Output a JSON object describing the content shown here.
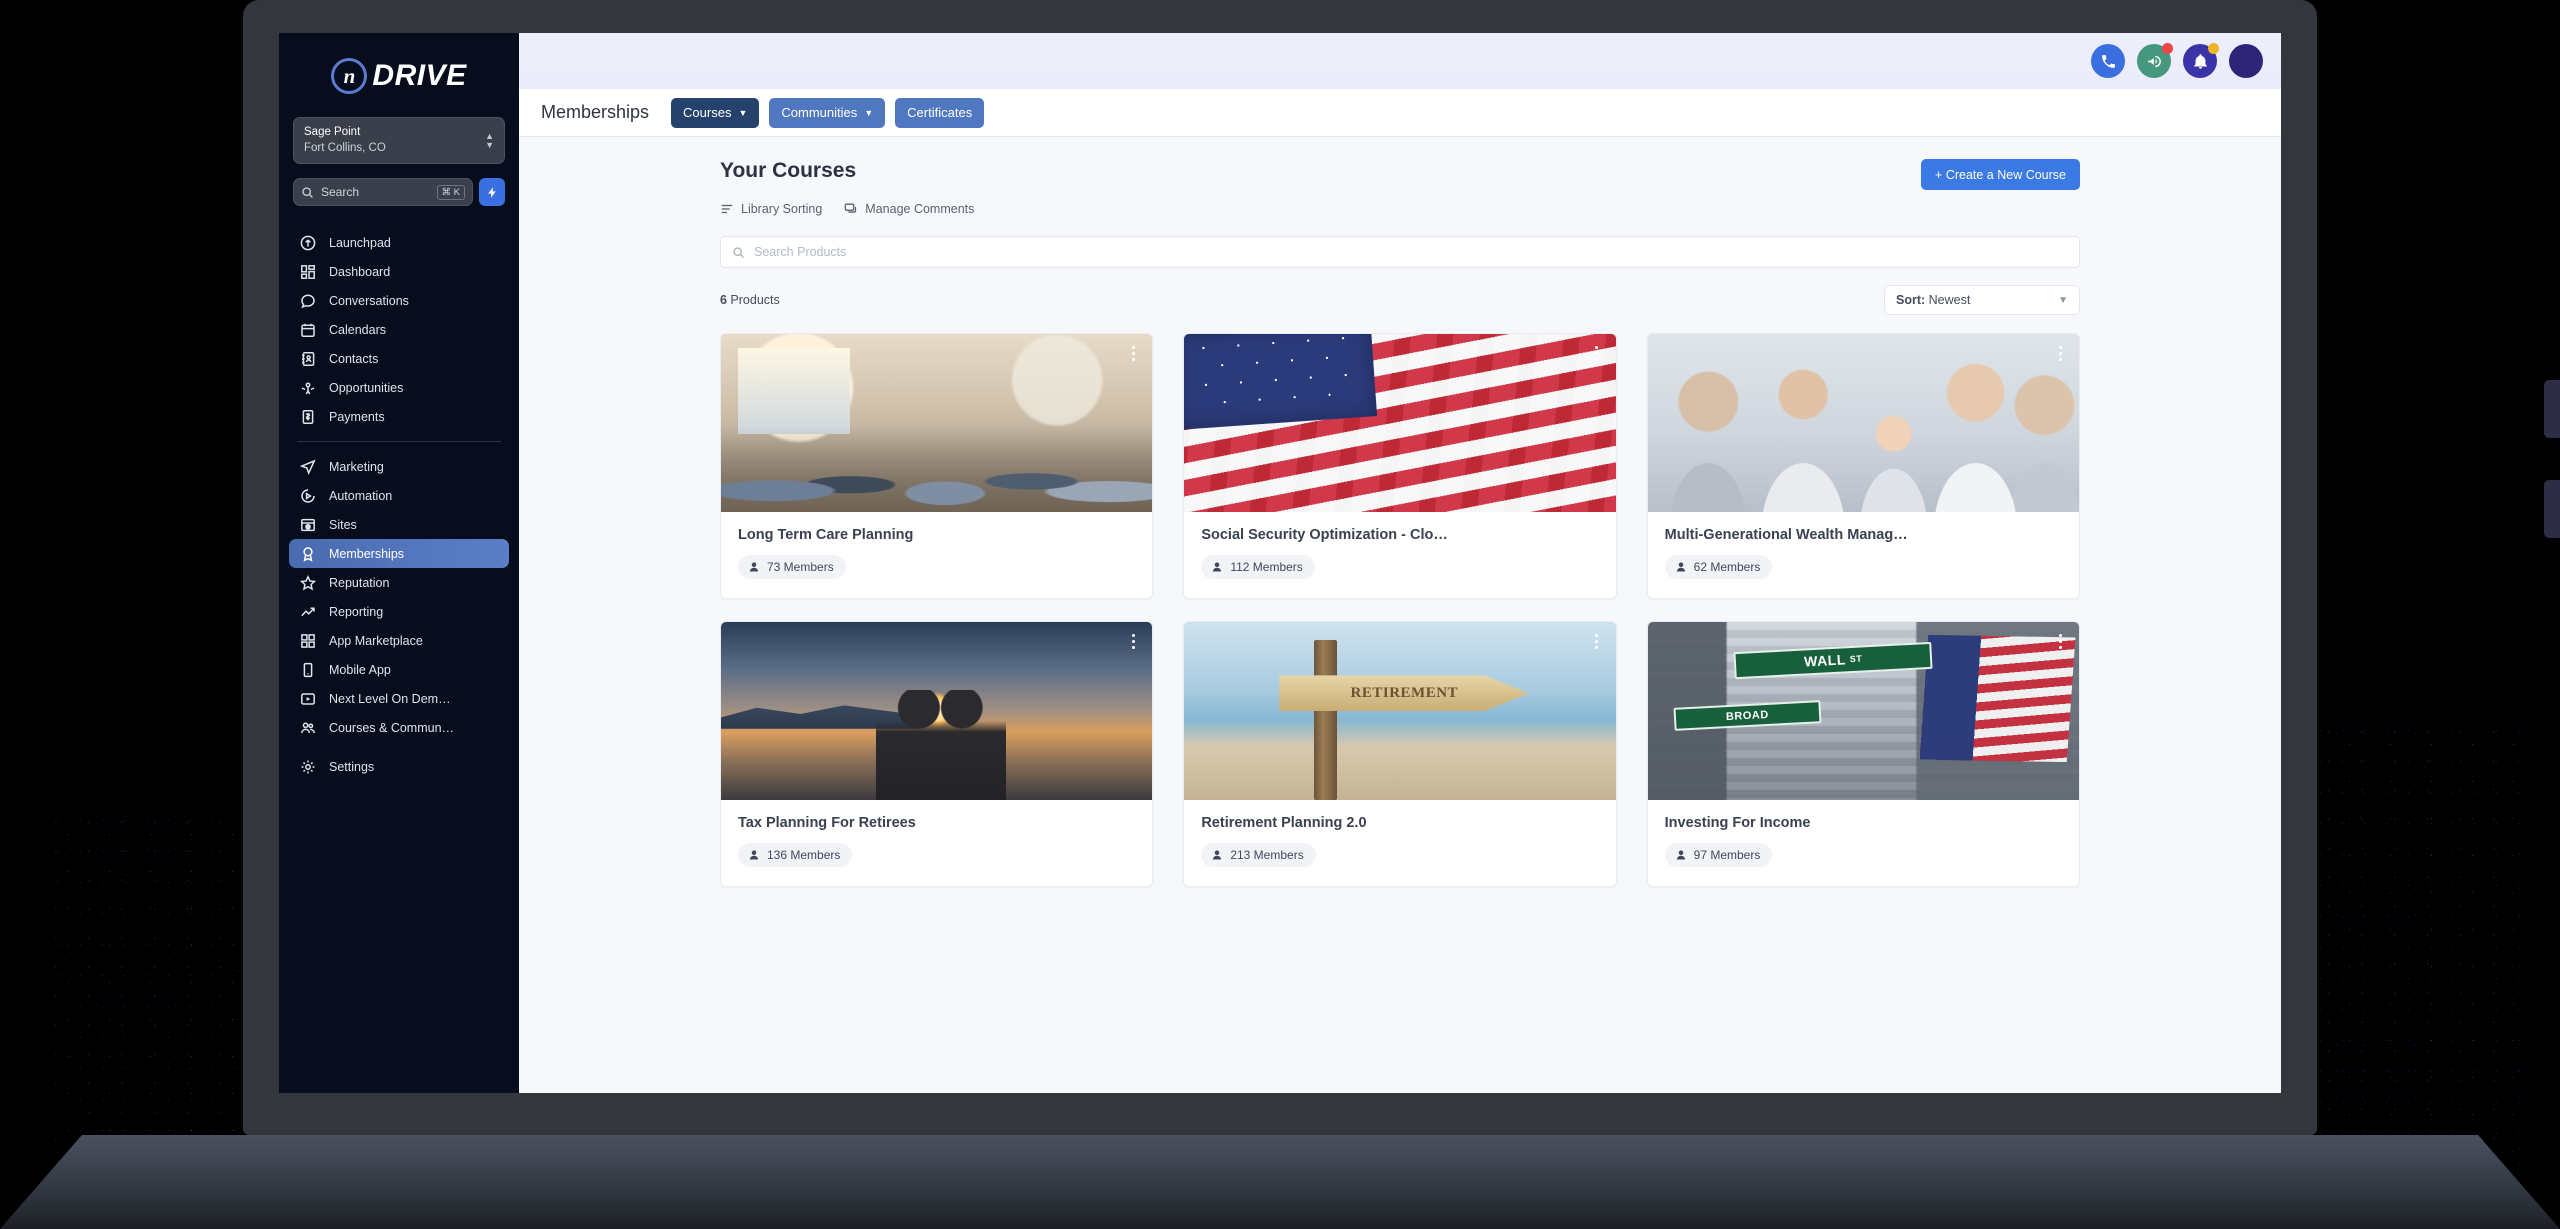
{
  "brand": {
    "mark": "n",
    "word": "DRIVE"
  },
  "org": {
    "name": "Sage Point",
    "location": "Fort Collins, CO"
  },
  "sidebar": {
    "search": {
      "placeholder": "Search",
      "shortcut": "⌘ K"
    },
    "items": [
      {
        "label": "Launchpad",
        "icon": "rocket-icon",
        "active": false
      },
      {
        "label": "Dashboard",
        "icon": "dashboard-icon",
        "active": false
      },
      {
        "label": "Conversations",
        "icon": "chat-icon",
        "active": false
      },
      {
        "label": "Calendars",
        "icon": "calendar-icon",
        "active": false
      },
      {
        "label": "Contacts",
        "icon": "contacts-icon",
        "active": false
      },
      {
        "label": "Opportunities",
        "icon": "opportunities-icon",
        "active": false
      },
      {
        "label": "Payments",
        "icon": "payments-icon",
        "active": false
      },
      {
        "label": "Marketing",
        "icon": "send-icon",
        "active": false
      },
      {
        "label": "Automation",
        "icon": "automation-icon",
        "active": false
      },
      {
        "label": "Sites",
        "icon": "sites-icon",
        "active": false
      },
      {
        "label": "Memberships",
        "icon": "badge-icon",
        "active": true
      },
      {
        "label": "Reputation",
        "icon": "star-icon",
        "active": false
      },
      {
        "label": "Reporting",
        "icon": "trending-up-icon",
        "active": false
      },
      {
        "label": "App Marketplace",
        "icon": "grid-icon",
        "active": false
      },
      {
        "label": "Mobile App",
        "icon": "mobile-icon",
        "active": false
      },
      {
        "label": "Next Level On Dem…",
        "icon": "video-icon",
        "active": false
      },
      {
        "label": "Courses & Commun…",
        "icon": "people-icon",
        "active": false
      },
      {
        "label": "Settings",
        "icon": "gear-icon",
        "active": false
      }
    ]
  },
  "topbar": {
    "icons": [
      {
        "name": "phone-icon",
        "badge": null
      },
      {
        "name": "megaphone-icon",
        "badge": "#ef4444"
      },
      {
        "name": "bell-icon",
        "badge": "#f0b429"
      },
      {
        "name": "avatar",
        "badge": null
      }
    ]
  },
  "header": {
    "title": "Memberships",
    "tabs": [
      {
        "label": "Courses",
        "caret": true,
        "style": "dark"
      },
      {
        "label": "Communities",
        "caret": true,
        "style": "light"
      },
      {
        "label": "Certificates",
        "caret": false,
        "style": "light"
      }
    ]
  },
  "main": {
    "page_heading": "Your Courses",
    "create_button": "+ Create a New Course",
    "sub_actions": [
      {
        "label": "Library Sorting",
        "icon": "sort-lines-icon"
      },
      {
        "label": "Manage Comments",
        "icon": "comments-icon"
      }
    ],
    "search": {
      "placeholder": "Search Products",
      "value": ""
    },
    "count_number": "6",
    "count_label": " Products",
    "sort": {
      "prefix": "Sort:",
      "value": " Newest"
    }
  },
  "courses": [
    {
      "title": "Long Term Care Planning",
      "members": "73 Members",
      "art": "ltc"
    },
    {
      "title": "Social Security Optimization - Clo…",
      "members": "112 Members",
      "art": "flag"
    },
    {
      "title": "Multi-Generational Wealth Manag…",
      "members": "62 Members",
      "art": "family"
    },
    {
      "title": "Tax Planning For Retirees",
      "members": "136 Members",
      "art": "sunset"
    },
    {
      "title": "Retirement Planning 2.0",
      "members": "213 Members",
      "art": "sign"
    },
    {
      "title": "Investing For Income",
      "members": "97 Members",
      "art": "wall"
    }
  ],
  "artwork_text": {
    "retirement_sign": "RETIREMENT",
    "wall_street": "WALL",
    "wall_street_suffix": "ST",
    "broad_street": "BROAD"
  },
  "colors": {
    "accent_blue": "#3b7ae4",
    "tab_dark": "#25426d",
    "tab_light": "#5078c0",
    "sidebar_bg": "#070d1c",
    "sidebar_active": "#5b7ec6",
    "canvas": "#f7f8fb"
  }
}
